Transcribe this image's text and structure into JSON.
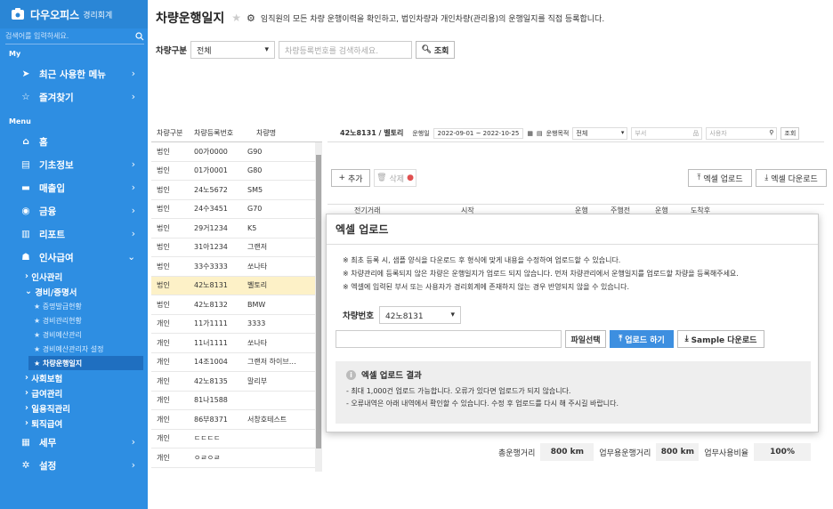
{
  "sidebar": {
    "brand": "다우오피스",
    "brand_sub": "경리회계",
    "search_placeholder": "검색어를 입력하세요.",
    "my_label": "My",
    "my_items": [
      {
        "label": "최근 사용한 메뉴"
      },
      {
        "label": "즐겨찾기"
      }
    ],
    "menu_label": "Menu",
    "items": [
      {
        "label": "홈"
      },
      {
        "label": "기초정보"
      },
      {
        "label": "매출입"
      },
      {
        "label": "금융"
      },
      {
        "label": "리포트"
      },
      {
        "label": "인사급여"
      }
    ],
    "hr_sub": [
      "인사관리",
      "경비/증명서"
    ],
    "expense_sub": [
      "증명발급현황",
      "경비관리현황",
      "경비예산관리",
      "경비예산관리자 설정",
      "차량운행일지"
    ],
    "hr_sub2": [
      "사회보험",
      "급여관리",
      "일용직관리",
      "퇴직급여"
    ],
    "bottom_items": [
      {
        "label": "세무"
      },
      {
        "label": "설정"
      }
    ]
  },
  "header": {
    "title": "차량운행일지",
    "description": "임직원의 모든 차량 운행이력을 확인하고, 법인차량과 개인차량(관리용)의 운행일지를 직접 등록합니다."
  },
  "filter": {
    "type_label": "차량구분",
    "type_value": "전체",
    "search_placeholder": "차량등록번호를 검색하세요.",
    "search_button": "조회"
  },
  "vehicle_list": {
    "headers": [
      "차량구분",
      "차량등록번호",
      "차량명"
    ],
    "rows": [
      [
        "법인",
        "00가0000",
        "G90"
      ],
      [
        "법인",
        "01가0001",
        "G80"
      ],
      [
        "법인",
        "24노5672",
        "SM5"
      ],
      [
        "법인",
        "24수3451",
        "G70"
      ],
      [
        "법인",
        "29거1234",
        "K5"
      ],
      [
        "법인",
        "31아1234",
        "그랜저"
      ],
      [
        "법인",
        "33수3333",
        "쏘나타"
      ],
      [
        "법인",
        "42노8131",
        "벨토리"
      ],
      [
        "법인",
        "42노8132",
        "BMW"
      ],
      [
        "개인",
        "11가1111",
        "3333"
      ],
      [
        "개인",
        "11너1111",
        "쏘나타"
      ],
      [
        "개인",
        "14조1004",
        "그랜저 하이브…"
      ],
      [
        "개인",
        "42노8135",
        "말리부"
      ],
      [
        "개인",
        "81나1588",
        ""
      ],
      [
        "개인",
        "86부8371",
        "서창호테스트"
      ],
      [
        "개인",
        "ㄷㄷㄷㄷ",
        ""
      ],
      [
        "개인",
        "ㅇㄹㅇㄹ",
        ""
      ]
    ],
    "selected_index": 7
  },
  "detail": {
    "vehicle": "42노8131 / 벨토리",
    "date_label": "운행일",
    "date_range": "2022-09-01 ~ 2022-10-25",
    "purpose_label": "운행목적",
    "purpose_value": "전체",
    "dept_placeholder": "부서",
    "user_placeholder": "사용자",
    "search_button": "조회",
    "add_button": "추가",
    "delete_button": "삭제",
    "excel_upload": "엑셀 업로드",
    "excel_download": "엑셀 다운로드",
    "grid_headers": [
      "전기거래",
      "시작",
      "운행",
      "주행전",
      "운행",
      "도착후"
    ]
  },
  "totals": {
    "total_label": "총운행거리",
    "total_value": "800 km",
    "business_label": "업무용운행거리",
    "business_value": "800 km",
    "ratio_label": "업무사용비율",
    "ratio_value": "100%"
  },
  "modal": {
    "title": "엑셀 업로드",
    "notes": [
      "※ 최초 등록 시, 샘플 양식을 다운로드 후 형식에 맞게 내용을 수정하여 업로드할 수 있습니다.",
      "※ 차량관리에 등록되지 않은 차량은 운행일지가 업로드 되지 않습니다. 먼저 차량관리에서 운행일지를 업로드할 차량을 등록해주세요.",
      "※ 엑셀에 입력된 부서 또는 사용자가 경리회계에 존재하지 않는 경우 반영되지 않을 수 있습니다."
    ],
    "vehicle_label": "차량번호",
    "vehicle_value": "42노8131",
    "file_button": "파일선택",
    "upload_button": "업로드 하기",
    "sample_button": "Sample 다운로드",
    "result_title": "엑셀 업로드 결과",
    "result_lines": [
      "- 최대 1,000건 업로드 가능합니다. 오류가 있다면 업로드가 되지 않습니다.",
      "- 오류내역은 아래 내역에서 확인할 수 있습니다. 수정 후 업로드를 다시 해 주시길 바랍니다."
    ]
  },
  "colors": {
    "sidebar": "#2e8ee2",
    "active": "#1f6fc0",
    "primary_button": "#3d8fe0",
    "selected_row": "#fdf1c7"
  }
}
